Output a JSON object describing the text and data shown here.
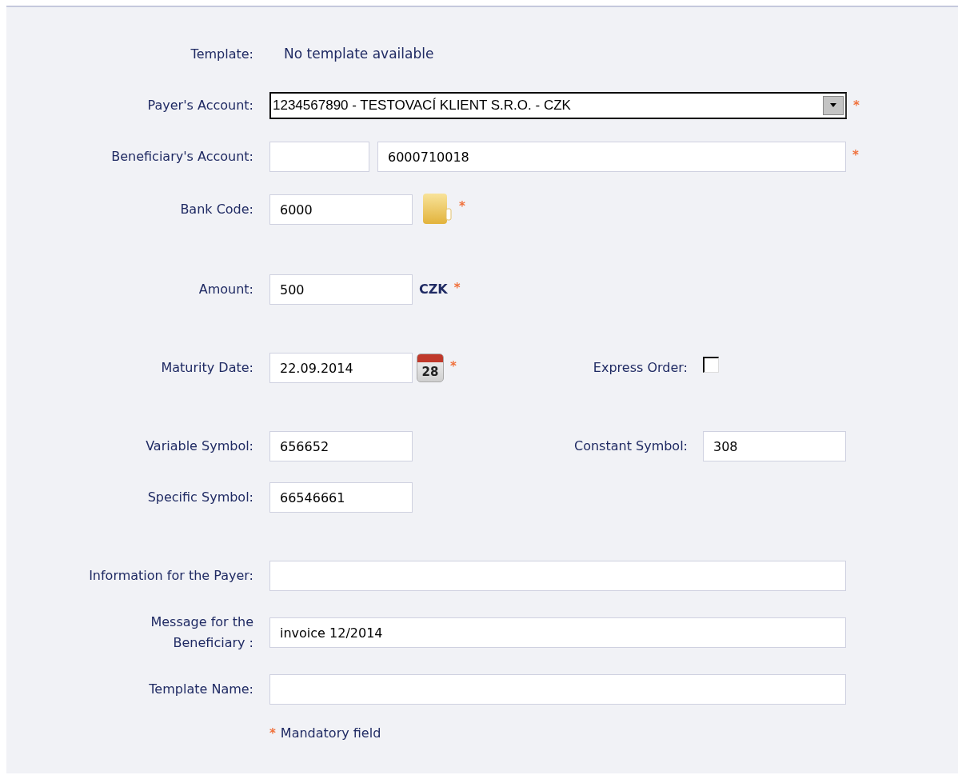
{
  "groups": [
    {
      "rows": [
        {
          "label": "Template:",
          "kind": "static",
          "value": "No template available"
        },
        {
          "label": "Payer's Account:",
          "kind": "select",
          "value": "1234567890 - TESTOVACÍ KLIENT S.R.O. - CZK",
          "required_mark": "*"
        },
        {
          "label": "Beneficiary's Account:",
          "kind": "split",
          "value": "6000710018",
          "required_mark": "*"
        },
        {
          "label": "Bank Code:",
          "kind": "short",
          "value": "6000",
          "button": {
            "kind": "directory"
          },
          "required_mark": "*"
        }
      ]
    },
    {
      "rows": [
        {
          "label": "Amount:",
          "kind": "short",
          "value": "500",
          "unit": "CZK",
          "required_mark": "*"
        }
      ]
    },
    {
      "rows": [
        {
          "label": "Maturity Date:",
          "kind": "short",
          "value": "22.09.2014",
          "button": {
            "kind": "calendar",
            "text": "28"
          },
          "required_mark": "*",
          "side": {
            "label": "Express Order:",
            "kind": "checkbox",
            "checked": false
          }
        }
      ]
    },
    {
      "rows": [
        {
          "label": "Variable Symbol:",
          "kind": "short",
          "value": "656652",
          "side": {
            "label": "Constant Symbol:",
            "kind": "short",
            "value": "308"
          }
        },
        {
          "label": "Specific Symbol:",
          "kind": "short",
          "value": "66546661"
        }
      ]
    },
    {
      "rows": [
        {
          "label": "Information for the Payer:",
          "kind": "wide"
        },
        {
          "label": "Message for the\nBeneficiary :",
          "kind": "wide",
          "value": "invoice 12/2014"
        },
        {
          "label": "Template Name:",
          "kind": "wide"
        }
      ]
    }
  ],
  "footer": {
    "mark": "*",
    "text": "Mandatory field"
  }
}
